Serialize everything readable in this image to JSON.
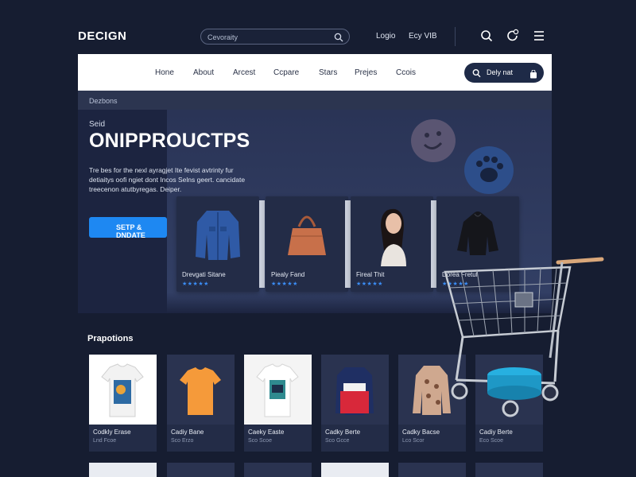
{
  "brand": "DECIGN",
  "search": {
    "placeholder": "Cevoraity"
  },
  "top_links": [
    "Logio",
    "Ecy VIB"
  ],
  "top_icons": [
    "search-icon",
    "refresh-icon",
    "menu-icon"
  ],
  "nav": {
    "items": [
      "Hone",
      "About",
      "Arcest",
      "Ccpare",
      "Stars",
      "Prejes",
      "Ccois"
    ],
    "deals_button": "Dely nat"
  },
  "breadcrumb": "Dezbons",
  "hero": {
    "eyebrow": "Seid",
    "title": "ONIPPROUCTPS",
    "description": "Tre bes for the nexl ayragjet Ite fevist avtrinty fur detiaitys oofi ngiet dont Incos Selns geert. cancidate treecenon atutbyregas. Deiper.",
    "cta": "SETP & DNDATE"
  },
  "featured": [
    {
      "name": "Drevgati Sitane",
      "stars": "★★★★★",
      "icon": "denim-jacket-image"
    },
    {
      "name": "Piealy Fand",
      "stars": "★★★★★",
      "icon": "handbag-image"
    },
    {
      "name": "Fireal Thit",
      "stars": "★★★★★",
      "icon": "model-portrait-image"
    },
    {
      "name": "Dorea Fretuf",
      "stars": "★★★★★",
      "icon": "black-jacket-image"
    }
  ],
  "promotions": {
    "title": "Prapotions",
    "items": [
      {
        "name": "Codkly Erase",
        "price": "Lnd Fcoe",
        "icon": "graphic-tee-image"
      },
      {
        "name": "Cadiy Bane",
        "price": "Sco Erzo",
        "icon": "orange-tee-image"
      },
      {
        "name": "Caeky Easte",
        "price": "Sco Scoe",
        "icon": "print-tee-image"
      },
      {
        "name": "Cadky Berte",
        "price": "Sco Gcce",
        "icon": "colorblock-jacket-image"
      },
      {
        "name": "Cadky Bacse",
        "price": "Lco Scor",
        "icon": "patterned-cardigan-image"
      },
      {
        "name": "Cadiy Berte",
        "price": "Eco Scoe",
        "icon": "blue-stroller-image"
      }
    ]
  },
  "colors": {
    "background": "#161d31",
    "navbar": "#ffffff",
    "accent": "#1e88f2",
    "card": "#232c47"
  }
}
